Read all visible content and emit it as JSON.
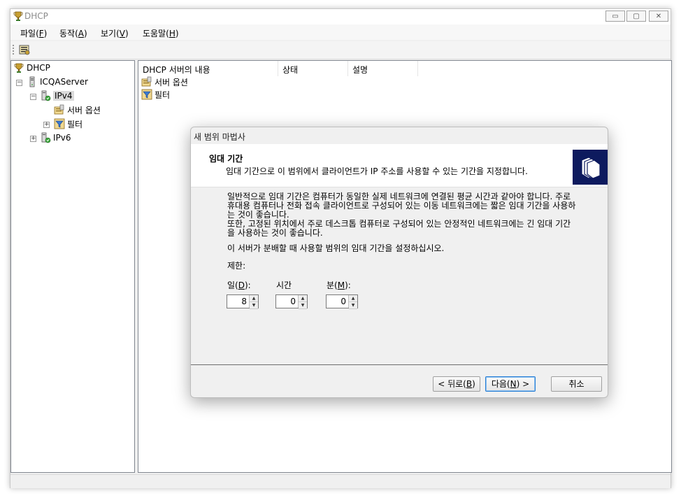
{
  "window": {
    "title": "DHCP",
    "controls": {
      "minimize": "▭",
      "restore": "▢",
      "close": "✕"
    }
  },
  "menu": [
    {
      "label": "파일(F)",
      "text": "파일(",
      "key": "F",
      "end": ")"
    },
    {
      "label": "동작(A)",
      "text": "동작(",
      "key": "A",
      "end": ")"
    },
    {
      "label": "보기(V)",
      "text": "보기(",
      "key": "V",
      "end": ")"
    },
    {
      "label": "도움말(H)",
      "text": "도움말(",
      "key": "H",
      "end": ")"
    }
  ],
  "tree": {
    "root": "DHCP",
    "server": "ICQAServer",
    "ipv4": "IPv4",
    "server_options": "서버 옵션",
    "filters": "필터",
    "ipv6": "IPv6"
  },
  "list": {
    "columns": [
      "DHCP 서버의 내용",
      "상태",
      "설명"
    ],
    "rows": [
      "서버 옵션",
      "필터"
    ]
  },
  "dialog": {
    "title": "새 범위 마법사",
    "heading": "임대 기간",
    "subheading": "임대 기간으로 이 범위에서 클라이언트가 IP 주소를 사용할 수 있는 기간을 지정합니다.",
    "para1": "일반적으로 임대 기간은 컴퓨터가 동일한 실제 네트워크에 연결된 평균 시간과 같아야 합니다. 주로 휴대용 컴퓨터나 전화 접속 클라이언트로 구성되어 있는 이동 네트워크에는 짧은 임대 기간을 사용하는 것이 좋습니다.",
    "para2": "또한, 고정된 위치에서 주로 데스크톱 컴퓨터로 구성되어 있는 안정적인 네트워크에는 긴 임대 기간을 사용하는 것이 좋습니다.",
    "instruction": "이 서버가 분배할 때 사용할 범위의 임대 기간을 설정하십시오.",
    "limit_label": "제한:",
    "days_label": {
      "text": "일(",
      "key": "D",
      "end": "):"
    },
    "hours_label": "시간",
    "minutes_label": {
      "text": "분(",
      "key": "M",
      "end": "):"
    },
    "days_value": "8",
    "hours_value": "0",
    "minutes_value": "0",
    "back_button": {
      "text": "< 뒤로(",
      "key": "B",
      "end": ")"
    },
    "next_button": {
      "text": "다음(",
      "key": "N",
      "end": ") >"
    },
    "cancel_button": "취소"
  }
}
